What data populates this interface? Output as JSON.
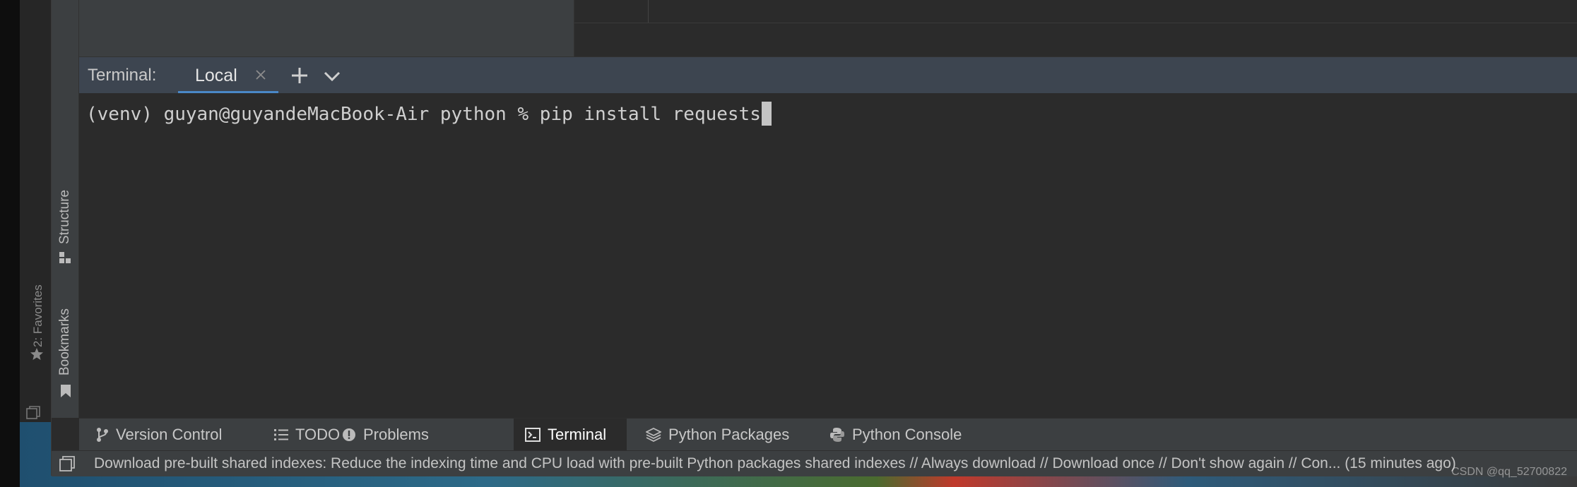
{
  "outer_window": {
    "favorites_label": "2: Favorites",
    "favorites_icon": "star-icon",
    "square_icon": "frame-icon"
  },
  "side_stripe": {
    "structure_label": "Structure",
    "structure_icon": "structure-icon",
    "bookmarks_label": "Bookmarks",
    "bookmarks_icon": "bookmark-icon"
  },
  "terminal": {
    "title": "Terminal:",
    "tabs": [
      {
        "label": "Local",
        "active": true,
        "closable": true
      }
    ],
    "new_tab_icon": "plus-icon",
    "menu_icon": "chevron-down-icon",
    "prompt": "(venv) guyan@guyandeMacBook-Air python % ",
    "command": "pip install requests"
  },
  "tool_windows": [
    {
      "label": "Version Control",
      "icon": "branch-icon",
      "active": false
    },
    {
      "label": "TODO",
      "icon": "list-icon",
      "active": false
    },
    {
      "label": "Problems",
      "icon": "warning-icon",
      "active": false
    },
    {
      "label": "Terminal",
      "icon": "terminal-icon",
      "active": true
    },
    {
      "label": "Python Packages",
      "icon": "layers-icon",
      "active": false
    },
    {
      "label": "Python Console",
      "icon": "python-icon",
      "active": false
    }
  ],
  "status_bar": {
    "message": "Download pre-built shared indexes: Reduce the indexing time and CPU load with pre-built Python packages shared indexes // Always download // Download once // Don't show again // Con... (15 minutes ago)"
  },
  "watermark": "CSDN @qq_52700822",
  "colors": {
    "accent": "#4a88c7",
    "terminal_header": "#3d4550",
    "panel": "#3c3f41",
    "editor_bg": "#2b2b2b"
  }
}
